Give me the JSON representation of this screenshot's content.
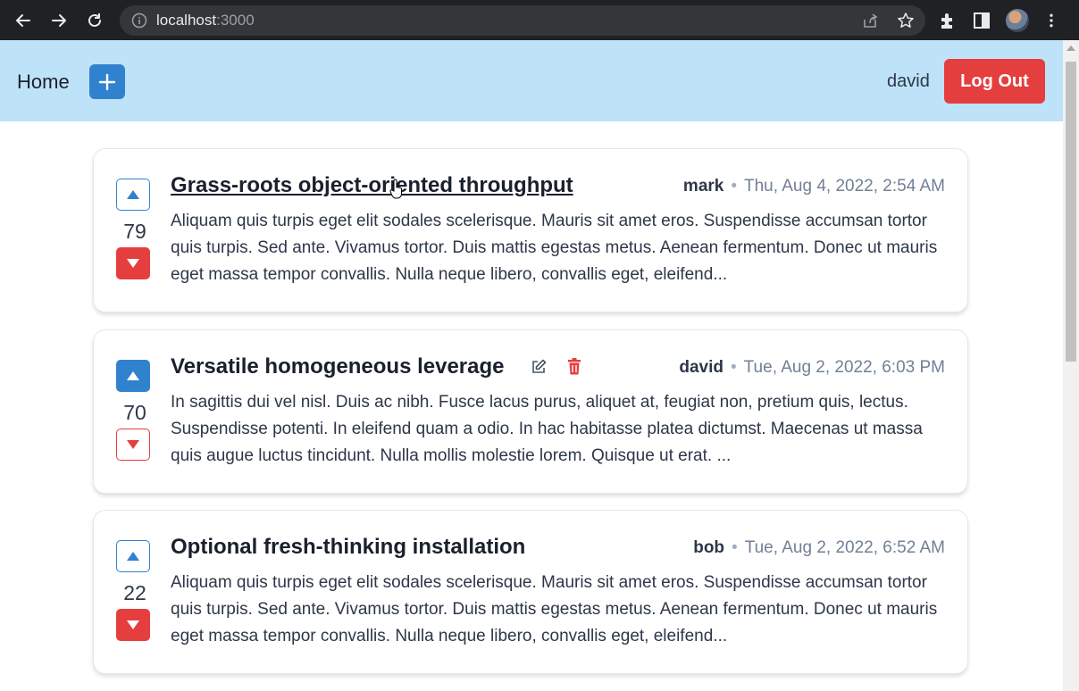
{
  "browser": {
    "url_host": "localhost",
    "url_port": ":3000"
  },
  "nav": {
    "home_label": "Home",
    "username": "david",
    "logout_label": "Log Out"
  },
  "posts": [
    {
      "score": "79",
      "title": "Grass-roots object-oriented throughput",
      "author": "mark",
      "separator": "•",
      "date": "Thu, Aug 4, 2022, 2:54 AM",
      "body": "Aliquam quis turpis eget elit sodales scelerisque. Mauris sit amet eros. Suspendisse accumsan tortor quis turpis. Sed ante. Vivamus tortor. Duis mattis egestas metus. Aenean fermentum. Donec ut mauris eget massa tempor convallis. Nulla neque libero, convallis eget, eleifend..."
    },
    {
      "score": "70",
      "title": "Versatile homogeneous leverage",
      "author": "david",
      "separator": "•",
      "date": "Tue, Aug 2, 2022, 6:03 PM",
      "body": "In sagittis dui vel nisl. Duis ac nibh. Fusce lacus purus, aliquet at, feugiat non, pretium quis, lectus. Suspendisse potenti. In eleifend quam a odio. In hac habitasse platea dictumst. Maecenas ut massa quis augue luctus tincidunt. Nulla mollis molestie lorem. Quisque ut erat. ..."
    },
    {
      "score": "22",
      "title": "Optional fresh-thinking installation",
      "author": "bob",
      "separator": "•",
      "date": "Tue, Aug 2, 2022, 6:52 AM",
      "body": "Aliquam quis turpis eget elit sodales scelerisque. Mauris sit amet eros. Suspendisse accumsan tortor quis turpis. Sed ante. Vivamus tortor. Duis mattis egestas metus. Aenean fermentum. Donec ut mauris eget massa tempor convallis. Nulla neque libero, convallis eget, eleifend..."
    }
  ],
  "colors": {
    "nav_bg": "#bee3f8",
    "primary": "#3182ce",
    "danger": "#e53e3e"
  }
}
